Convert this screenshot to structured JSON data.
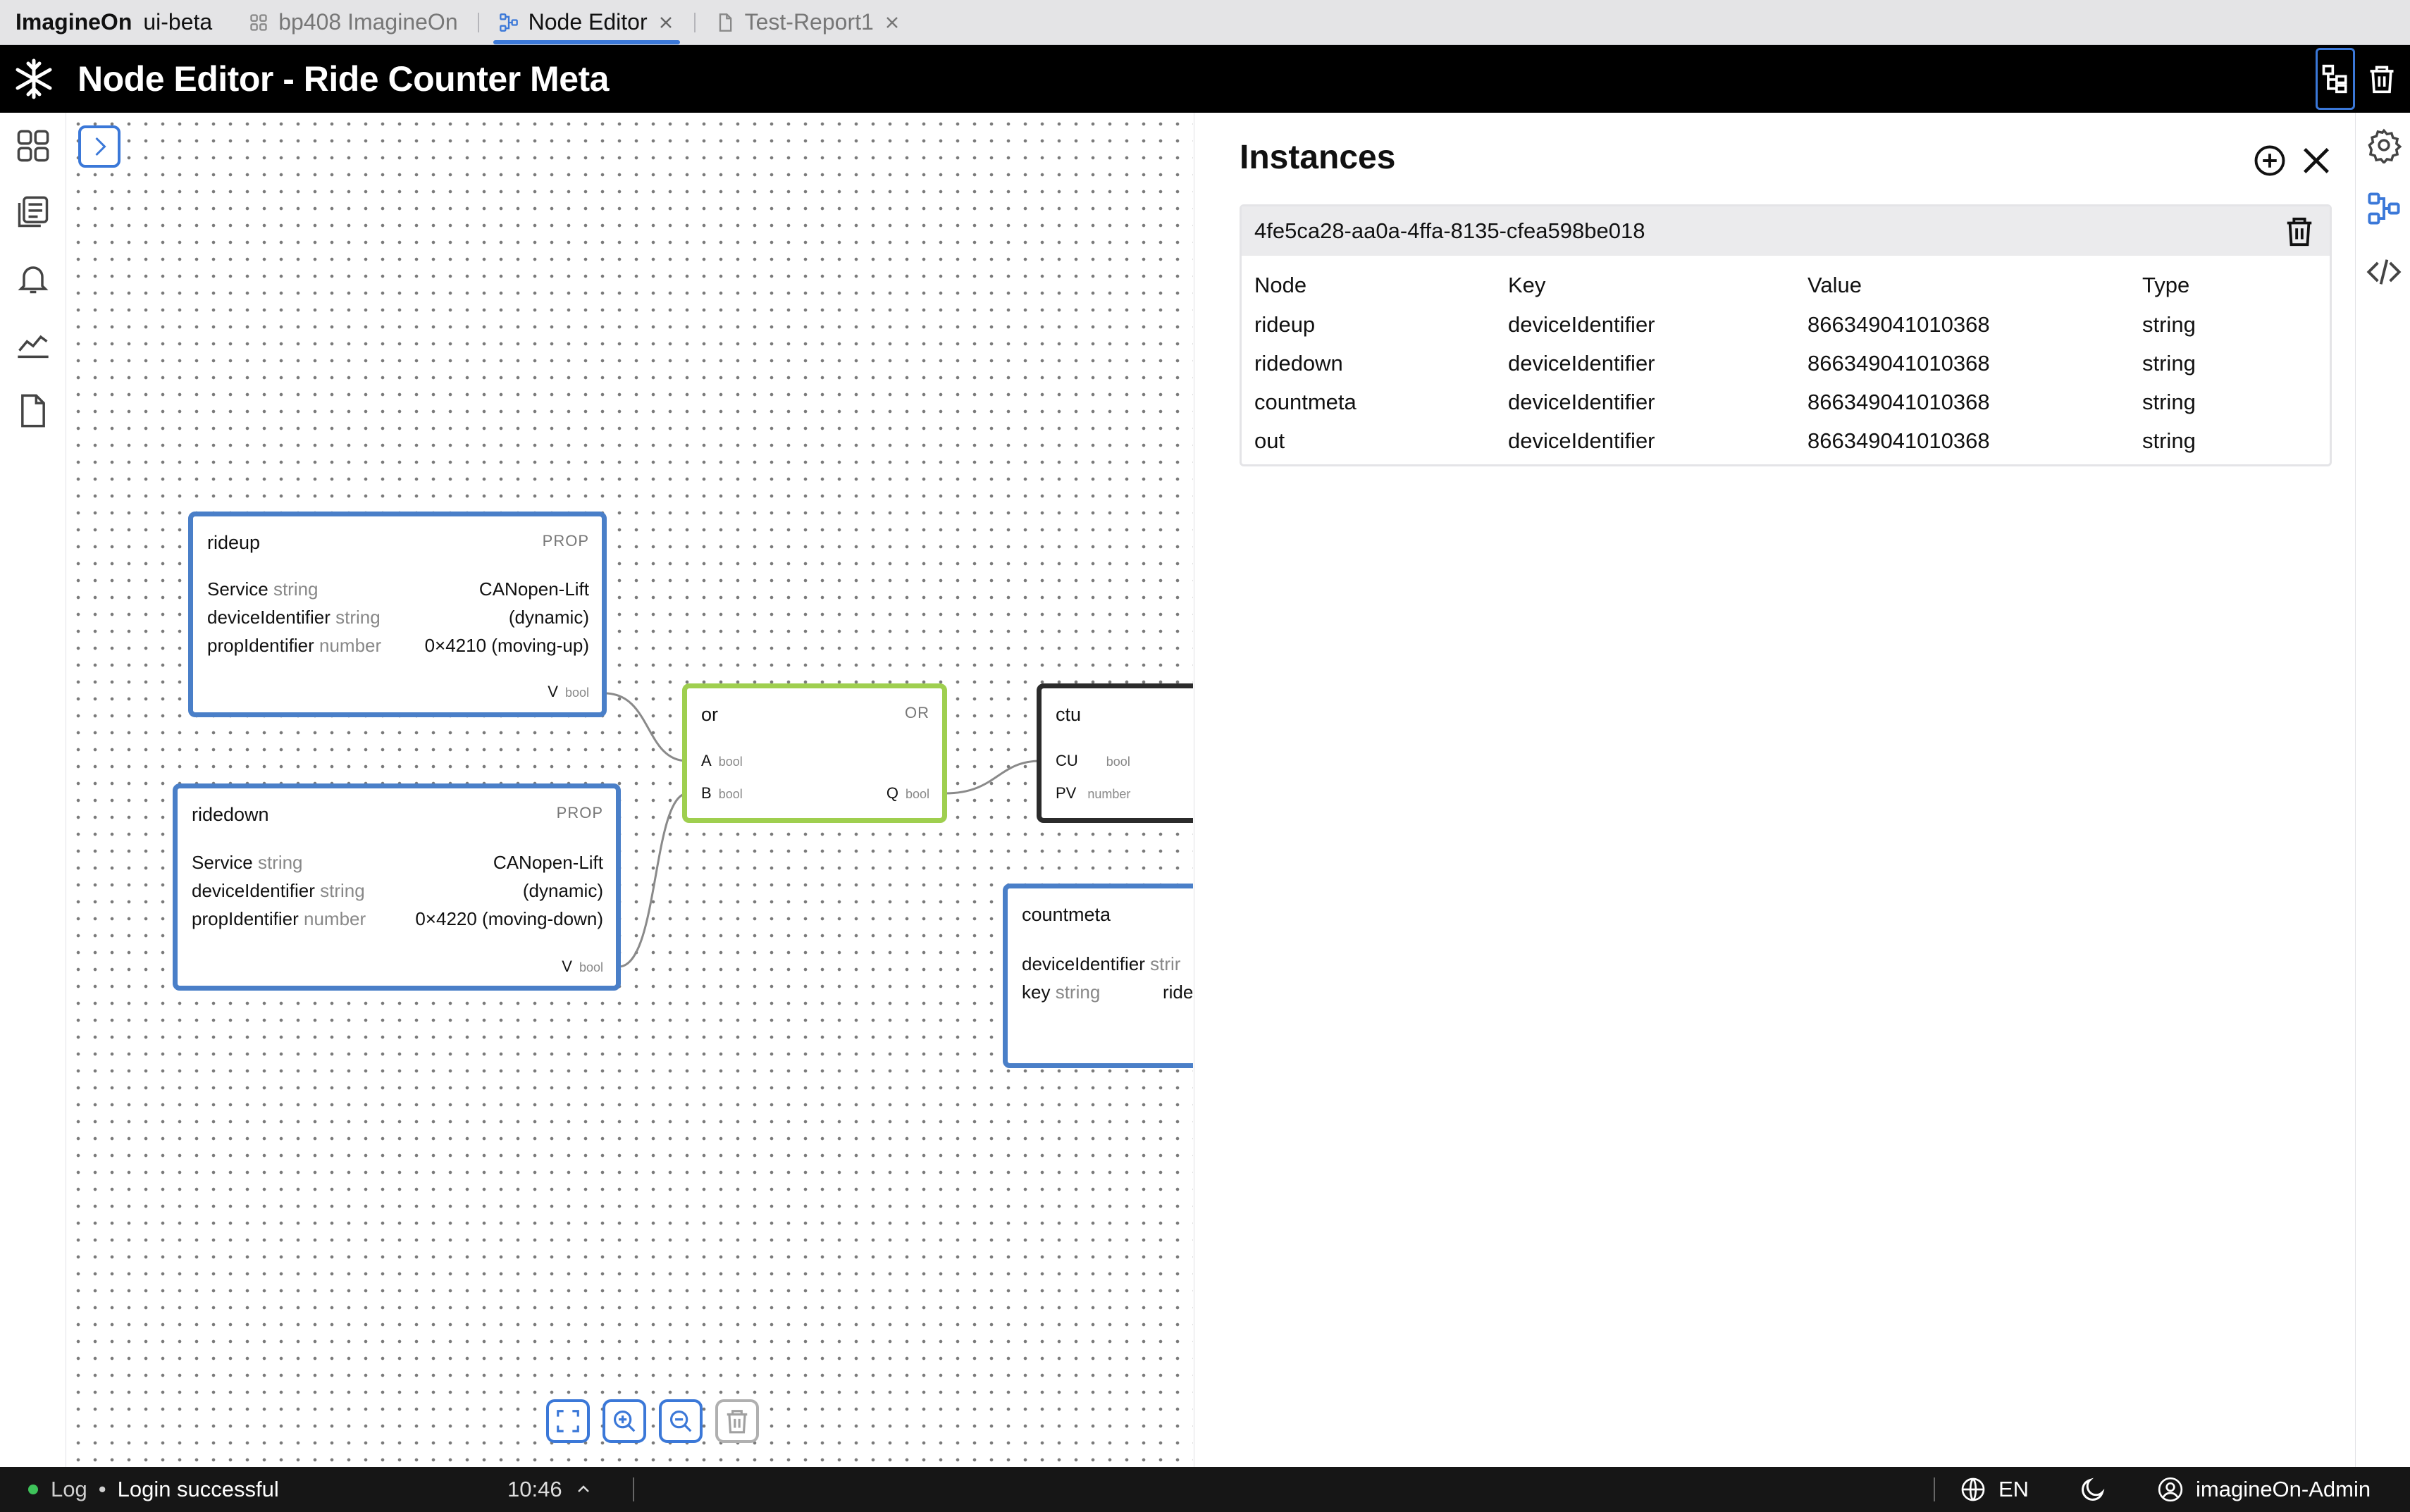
{
  "tabbar": {
    "brand_name": "ImagineOn",
    "brand_env": "ui-beta",
    "tabs": [
      {
        "label": "bp408 ImagineOn",
        "icon": "grid-icon",
        "active": false,
        "closable": false
      },
      {
        "label": "Node Editor",
        "icon": "node-graph-icon",
        "active": true,
        "closable": true
      },
      {
        "label": "Test-Report1",
        "icon": "document-icon",
        "active": false,
        "closable": true
      }
    ]
  },
  "header": {
    "title": "Node Editor - Ride Counter Meta",
    "logo": "snowflake-logo-icon",
    "actions": [
      "hierarchy-tree-icon",
      "trash-icon"
    ]
  },
  "left_sidebar": [
    "apps-grid-icon",
    "documents-icon",
    "bell-icon",
    "chart-line-icon",
    "file-icon"
  ],
  "right_sidebar": [
    "settings-gear-icon",
    "node-structure-icon",
    "code-icon"
  ],
  "nodes": {
    "rideup": {
      "title": "rideup",
      "badge": "PROP",
      "fields": [
        {
          "key": "Service",
          "type": "string",
          "value": "CANopen-Lift"
        },
        {
          "key": "deviceIdentifier",
          "type": "string",
          "value": "(dynamic)"
        },
        {
          "key": "propIdentifier",
          "type": "number",
          "value": "0×4210 (moving-up)"
        }
      ],
      "output": {
        "name": "V",
        "type": "bool"
      }
    },
    "ridedown": {
      "title": "ridedown",
      "badge": "PROP",
      "fields": [
        {
          "key": "Service",
          "type": "string",
          "value": "CANopen-Lift"
        },
        {
          "key": "deviceIdentifier",
          "type": "string",
          "value": "(dynamic)"
        },
        {
          "key": "propIdentifier",
          "type": "number",
          "value": "0×4220 (moving-down)"
        }
      ],
      "output": {
        "name": "V",
        "type": "bool"
      }
    },
    "or": {
      "title": "or",
      "badge": "OR",
      "inputs": [
        {
          "name": "A",
          "type": "bool"
        },
        {
          "name": "B",
          "type": "bool"
        }
      ],
      "output": {
        "name": "Q",
        "type": "bool"
      }
    },
    "ctu": {
      "title": "ctu",
      "inputs": [
        {
          "name": "CU",
          "type": "bool"
        },
        {
          "name": "PV",
          "type": "number"
        }
      ]
    },
    "countmeta": {
      "title": "countmeta",
      "fields": [
        {
          "key": "deviceIdentifier",
          "type": "strir",
          "value": ""
        },
        {
          "key": "key",
          "type": "string",
          "value": "ride"
        }
      ]
    }
  },
  "colors": {
    "prop_node_border": "#4a7fc8",
    "or_node_border": "#9fcf4f",
    "ctu_node_border": "#2b2b2b",
    "accent": "#3b78d8",
    "status_ok": "#3ec35a"
  },
  "canvas_tools": [
    "fit-view-icon",
    "zoom-in-icon",
    "zoom-out-icon",
    "trash-icon"
  ],
  "instances_panel": {
    "title": "Instances",
    "instance": {
      "id": "4fe5ca28-aa0a-4ffa-8135-cfea598be018",
      "columns": [
        "Node",
        "Key",
        "Value",
        "Type"
      ],
      "rows": [
        [
          "rideup",
          "deviceIdentifier",
          "866349041010368",
          "string"
        ],
        [
          "ridedown",
          "deviceIdentifier",
          "866349041010368",
          "string"
        ],
        [
          "countmeta",
          "deviceIdentifier",
          "866349041010368",
          "string"
        ],
        [
          "out",
          "deviceIdentifier",
          "866349041010368",
          "string"
        ]
      ]
    }
  },
  "statusbar": {
    "log_label": "Log",
    "message": "Login successful",
    "time": "10:46",
    "language": "EN",
    "user": "imagineOn-Admin"
  }
}
